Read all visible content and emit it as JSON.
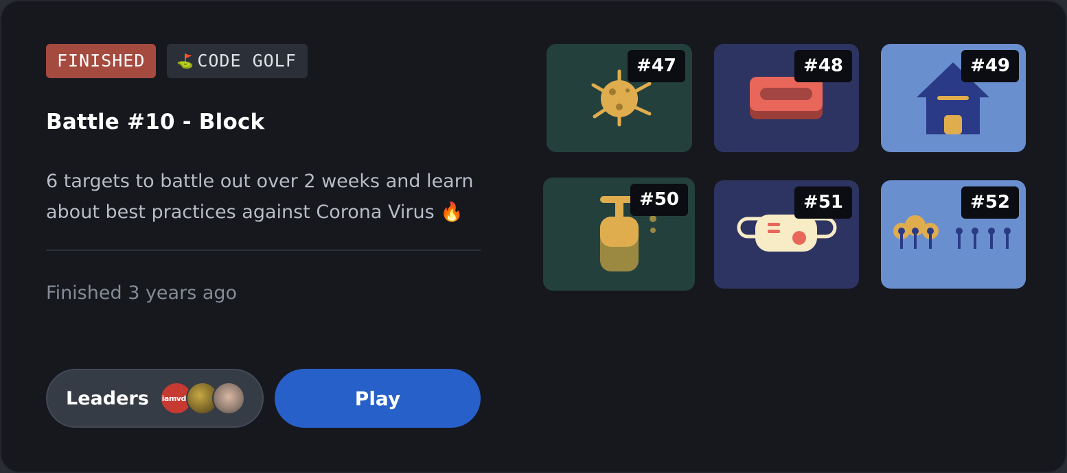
{
  "badges": {
    "status": "FINISHED",
    "mode_icon": "golf-flag-icon",
    "mode": "CODE GOLF"
  },
  "battle": {
    "title": "Battle #10 - Block",
    "description": "6 targets to battle out over 2 weeks and learn about best practices against Corona Virus 🔥",
    "status_text": "Finished 3 years ago"
  },
  "actions": {
    "leaders_label": "Leaders",
    "leader_avatars": [
      {
        "name": "iamvdo-avatar",
        "text": "iamvdo"
      },
      {
        "name": "leader-avatar-2",
        "text": ""
      },
      {
        "name": "leader-avatar-3",
        "text": ""
      }
    ],
    "play_label": "Play"
  },
  "targets": [
    {
      "number": "#47",
      "icon": "virus-icon",
      "bg": "#24403d"
    },
    {
      "number": "#48",
      "icon": "soap-bar-icon",
      "bg": "#2e3461"
    },
    {
      "number": "#49",
      "icon": "house-icon",
      "bg": "#6a8fcf"
    },
    {
      "number": "#50",
      "icon": "soap-dispenser-icon",
      "bg": "#24403d"
    },
    {
      "number": "#51",
      "icon": "face-mask-icon",
      "bg": "#2e3461"
    },
    {
      "number": "#52",
      "icon": "social-distancing-icon",
      "bg": "#6a8fcf"
    }
  ],
  "colors": {
    "finished_badge": "#a44a3f",
    "play_button": "#2760c9",
    "card_background": "#16181e"
  }
}
